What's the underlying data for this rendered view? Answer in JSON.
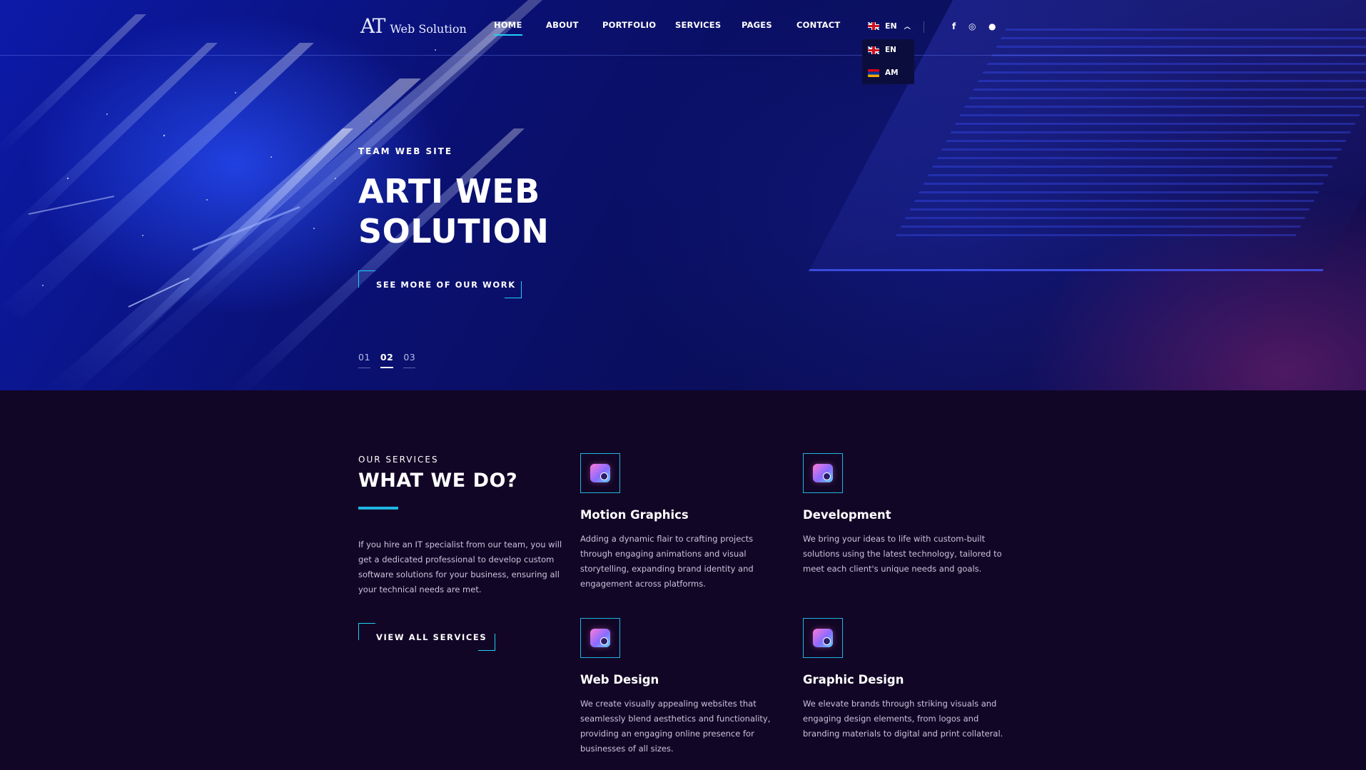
{
  "header": {
    "logo_mark": "AT",
    "logo_text": "Web Solution",
    "nav": [
      {
        "label": "HOME",
        "active": true
      },
      {
        "label": "ABOUT"
      },
      {
        "label": "PORTFOLIO"
      },
      {
        "label": "SERVICES"
      },
      {
        "label": "PAGES"
      },
      {
        "label": "CONTACT"
      }
    ],
    "language": {
      "current": "EN",
      "options": [
        "EN",
        "AM"
      ]
    },
    "social_icons": [
      "facebook-icon",
      "instagram-icon",
      "github-icon"
    ],
    "social_glyphs": [
      "f",
      "◎",
      "●"
    ]
  },
  "hero": {
    "eyebrow": "TEAM WEB SITE",
    "title_line1": "ARTI WEB",
    "title_line2": "SOLUTION",
    "cta": "SEE MORE OF OUR WORK",
    "slides": [
      "01",
      "02",
      "03"
    ],
    "active_slide": "02"
  },
  "services": {
    "eyebrow": "OUR SERVICES",
    "title": "WHAT WE DO?",
    "intro": "If you hire an IT specialist from our team, you will get a dedicated professional to develop custom software solutions for your business, ensuring all your technical needs are met.",
    "cta": "VIEW ALL SERVICES",
    "items": [
      {
        "title": "Motion Graphics",
        "icon": "motion-graphics-icon",
        "text": "Adding a dynamic flair to crafting projects through engaging animations and visual storytelling, expanding brand identity and engagement across platforms."
      },
      {
        "title": "Development",
        "icon": "development-icon",
        "text": "We bring your ideas to life with custom-built solutions using the latest technology, tailored to meet each client's unique needs and goals."
      },
      {
        "title": "Web Design",
        "icon": "web-design-icon",
        "text": "We create visually appealing websites that seamlessly blend aesthetics and functionality, providing an engaging online presence for businesses of all sizes."
      },
      {
        "title": "Graphic Design",
        "icon": "graphic-design-icon",
        "text": "We elevate brands through striking visuals and engaging design elements, from logos and branding materials to digital and print collateral."
      }
    ]
  },
  "colors": {
    "accent": "#1fd1f0",
    "page_bg": "#120626",
    "hero_blue": "#0c1aa8"
  }
}
